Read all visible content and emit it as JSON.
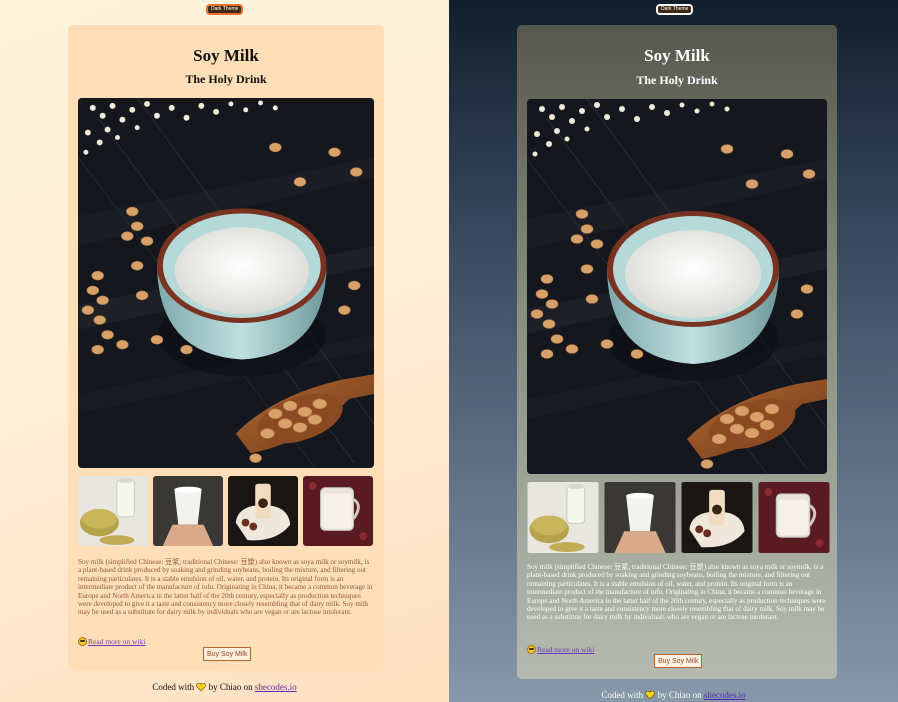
{
  "theme_toggle": {
    "label": "Dark Theme"
  },
  "card": {
    "title": "Soy Milk",
    "subtitle": "The Holy Drink",
    "hero_image_alt": "bowl of soy milk with soybeans",
    "thumbnails": [
      "soy milk bottle with soybeans",
      "cup of soy milk in hand",
      "soy milk bottle on plate",
      "glass of soy milk"
    ],
    "description": "Soy milk (simplified Chinese: 豆浆; traditional Chinese: 豆漿) also known as soya milk or soymilk, is a plant-based drink produced by soaking and grinding soybeans, boiling the mixture, and filtering out remaining particulates. It is a stable emulsion of oil, water, and protein. Its original form is an intermediate product of the manufacture of tofu. Originating in China, it became a common beverage in Europe and North America in the latter half of the 20th century, especially as production techniques were developed to give it a taste and consistency more closely resembling that of dairy milk. Soy milk may be used as a substitute for dairy milk by individuals who are vegan or are lactose intolerant.",
    "wiki_link": "Read more on wiki",
    "buy_button": "Buy Soy Milk"
  },
  "footer": {
    "prefix": "Coded with",
    "middle": "by Chiao on",
    "link": "shecodes.io"
  },
  "colors": {
    "light_bg": "#fff0da",
    "light_card": "#ffdeb8",
    "dark_bg": "#111e2c",
    "accent": "#e2702f",
    "link": "#6c3bb8"
  },
  "icons": [
    "smiley-icon",
    "heart-icon"
  ]
}
